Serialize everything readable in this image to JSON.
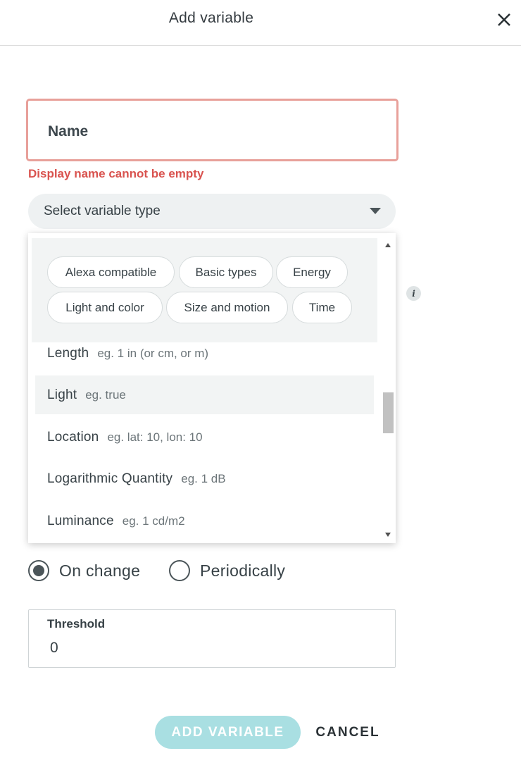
{
  "header": {
    "title": "Add variable",
    "close_icon": "close-icon"
  },
  "form": {
    "name_placeholder": "Name",
    "name_value": "",
    "name_error": "Display name cannot be empty",
    "type_select_label": "Select variable type"
  },
  "dropdown": {
    "chips": [
      {
        "label": "Alexa compatible"
      },
      {
        "label": "Basic types"
      },
      {
        "label": "Energy"
      },
      {
        "label": "Light and color"
      },
      {
        "label": "Size and motion"
      },
      {
        "label": "Time"
      }
    ],
    "options": [
      {
        "name": "Length",
        "example": "eg. 1 in (or cm, or m)"
      },
      {
        "name": "Light",
        "example": "eg. true"
      },
      {
        "name": "Location",
        "example": "eg. lat: 10, lon: 10"
      },
      {
        "name": "Logarithmic Quantity",
        "example": "eg. 1 dB"
      },
      {
        "name": "Luminance",
        "example": "eg. 1 cd/m2"
      }
    ],
    "highlighted_option": "Light"
  },
  "info_icon": "info-icon",
  "update_policy": {
    "options": [
      {
        "label": "On change",
        "checked": true
      },
      {
        "label": "Periodically",
        "checked": false
      }
    ]
  },
  "threshold": {
    "label": "Threshold",
    "value": "0"
  },
  "actions": {
    "add_label": "ADD VARIABLE",
    "cancel_label": "CANCEL"
  },
  "colors": {
    "error": "#d9534f",
    "error_border": "#e8a09a",
    "accent_disabled": "#a9dfe2",
    "select_bg": "#eef1f2"
  }
}
